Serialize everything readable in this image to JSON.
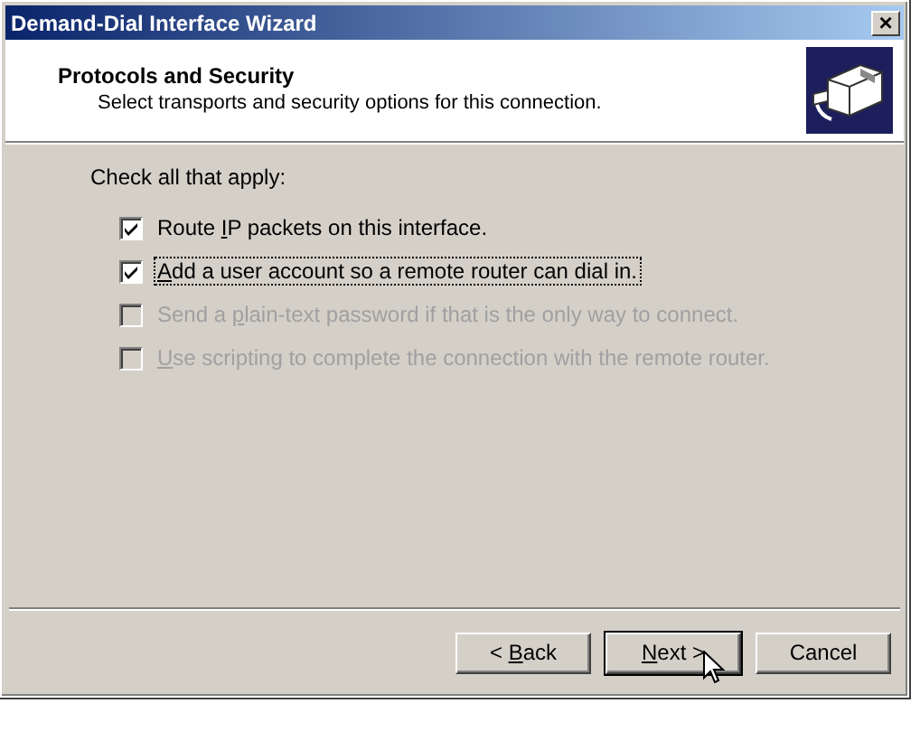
{
  "window": {
    "title": "Demand-Dial Interface Wizard",
    "close_glyph": "×"
  },
  "header": {
    "title": "Protocols and Security",
    "subtitle": "Select transports and security options for this connection."
  },
  "instruction": "Check all that apply:",
  "options": [
    {
      "before": "Route ",
      "key": "I",
      "after": "P packets on this interface.",
      "checked": true,
      "disabled": false,
      "focused": false
    },
    {
      "key": "A",
      "after": "dd a user account so a remote router can dial in.",
      "checked": true,
      "disabled": false,
      "focused": true
    },
    {
      "before": "Send a ",
      "key": "p",
      "after": "lain-text password if that is the only way to connect.",
      "checked": false,
      "disabled": true,
      "focused": false
    },
    {
      "key": "U",
      "after": "se scripting to complete the connection with the remote router.",
      "checked": false,
      "disabled": true,
      "focused": false
    }
  ],
  "buttons": [
    {
      "before": "< ",
      "key": "B",
      "after": "ack",
      "default": false
    },
    {
      "key": "N",
      "after": "ext >",
      "default": true
    },
    {
      "before": "Cancel",
      "default": false
    }
  ]
}
